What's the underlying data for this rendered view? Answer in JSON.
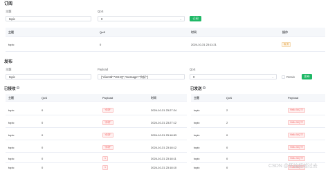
{
  "subscribe": {
    "title": "订阅",
    "topic_label": "主题",
    "topic_value": "topic",
    "qos_label": "QoS",
    "qos_value": "0",
    "button": "订阅",
    "table": {
      "headers": [
        "主题",
        "QoS",
        "时间",
        "操作"
      ],
      "rows": [
        {
          "topic": "topic",
          "qos": "0",
          "time": "2024-10-31 23:11:21",
          "action": "取消"
        }
      ]
    }
  },
  "publish": {
    "title": "发布",
    "topic_label": "主题",
    "topic_value": "topic",
    "payload_label": "Payload",
    "payload_value": "{\"clientId\":\"JKHQ\",\"message\":\"你好\"}",
    "qos_label": "QoS",
    "qos_value": "0",
    "retain_label": "Retain",
    "button": "发布"
  },
  "received": {
    "title": "已接收",
    "headers": [
      "主题",
      "QoS",
      "Payload",
      "时间"
    ],
    "rows": [
      {
        "topic": "topic",
        "qos": "0",
        "payload": "\"你好\"",
        "time": "2024-10-31 23:27:24"
      },
      {
        "topic": "topic",
        "qos": "0",
        "payload": "\"你好\"",
        "time": "2024-10-31 23:27:12"
      },
      {
        "topic": "topic",
        "qos": "0",
        "payload": "\"你好\"",
        "time": "2024-10-31 23:18:53"
      },
      {
        "topic": "topic",
        "qos": "0",
        "payload": "\"你好\"",
        "time": "2024-10-31 23:18:12"
      },
      {
        "topic": "topic",
        "qos": "0",
        "payload": "1",
        "time": "2024-10-31 23:18:11"
      },
      {
        "topic": "topic",
        "qos": "0",
        "payload": "1",
        "time": "2024-10-31 23:18:10"
      }
    ]
  },
  "sent": {
    "title": "已发送",
    "headers": [
      "主题",
      "QoS",
      "Payload"
    ],
    "rows": [
      {
        "topic": "topic",
        "qos": "2",
        "payload": "Hello MQTT"
      },
      {
        "topic": "topic",
        "qos": "2",
        "payload": "Hello MQTT"
      },
      {
        "topic": "topic",
        "qos": "0",
        "payload": "Hello MQTT"
      },
      {
        "topic": "topic",
        "qos": "0",
        "payload": "Hello MQTT"
      },
      {
        "topic": "topic",
        "qos": "0",
        "payload": "Hello MQTT"
      },
      {
        "topic": "topic",
        "qos": "0",
        "payload": "Hello MQTT"
      }
    ]
  },
  "watermark": "CSDN @怀铭超越过去"
}
